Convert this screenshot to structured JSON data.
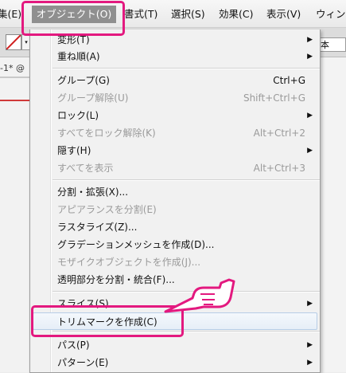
{
  "menubar": {
    "items": [
      {
        "label": "集(E)"
      },
      {
        "label": "オブジェクト(O)"
      },
      {
        "label": "書式(T)"
      },
      {
        "label": "選択(S)"
      },
      {
        "label": "効果(C)"
      },
      {
        "label": "表示(V)"
      },
      {
        "label": "ウィン"
      }
    ]
  },
  "toolbar": {
    "font_style_value": "本",
    "stroke_dropdown_glyph": "▾"
  },
  "document": {
    "tab_label": "-1* @"
  },
  "menu": {
    "items": [
      {
        "label": "変形(T)",
        "shortcut": "",
        "submenu": true,
        "disabled": false
      },
      {
        "label": "重ね順(A)",
        "shortcut": "",
        "submenu": true,
        "disabled": false
      },
      {
        "label": "グループ(G)",
        "shortcut": "Ctrl+G",
        "submenu": false,
        "disabled": false
      },
      {
        "label": "グループ解除(U)",
        "shortcut": "Shift+Ctrl+G",
        "submenu": false,
        "disabled": true
      },
      {
        "label": "ロック(L)",
        "shortcut": "",
        "submenu": true,
        "disabled": false
      },
      {
        "label": "すべてをロック解除(K)",
        "shortcut": "Alt+Ctrl+2",
        "submenu": false,
        "disabled": true
      },
      {
        "label": "隠す(H)",
        "shortcut": "",
        "submenu": true,
        "disabled": false
      },
      {
        "label": "すべてを表示",
        "shortcut": "Alt+Ctrl+3",
        "submenu": false,
        "disabled": true
      },
      {
        "label": "分割・拡張(X)...",
        "shortcut": "",
        "submenu": false,
        "disabled": false
      },
      {
        "label": "アピアランスを分割(E)",
        "shortcut": "",
        "submenu": false,
        "disabled": true
      },
      {
        "label": "ラスタライズ(Z)...",
        "shortcut": "",
        "submenu": false,
        "disabled": false
      },
      {
        "label": "グラデーションメッシュを作成(D)...",
        "shortcut": "",
        "submenu": false,
        "disabled": false
      },
      {
        "label": "モザイクオブジェクトを作成(J)...",
        "shortcut": "",
        "submenu": false,
        "disabled": true
      },
      {
        "label": "透明部分を分割・統合(F)...",
        "shortcut": "",
        "submenu": false,
        "disabled": false
      },
      {
        "label": "スライス(S)",
        "shortcut": "",
        "submenu": true,
        "disabled": false
      },
      {
        "label": "トリムマークを作成(C)",
        "shortcut": "",
        "submenu": false,
        "disabled": false,
        "highlighted": true
      },
      {
        "label": "パス(P)",
        "shortcut": "",
        "submenu": true,
        "disabled": false
      },
      {
        "label": "パターン(E)",
        "shortcut": "",
        "submenu": true,
        "disabled": false
      }
    ]
  },
  "colors": {
    "highlight_annotation": "#e3197f",
    "active_menu_bg": "#8f8f8f"
  }
}
